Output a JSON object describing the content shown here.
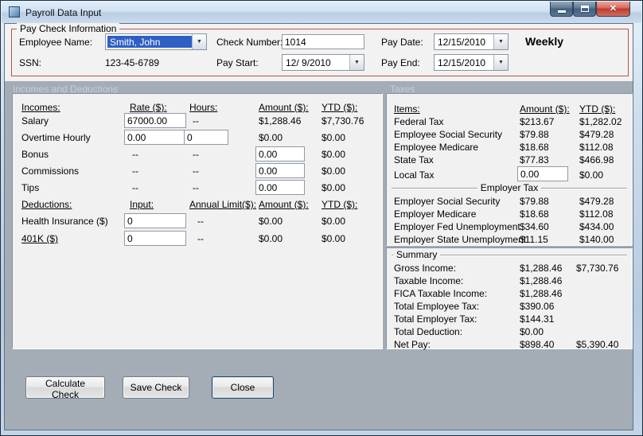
{
  "window": {
    "title": "Payroll Data Input",
    "close_glyph": "✕"
  },
  "icons": {
    "dropdown_arrow": "▼"
  },
  "paycheck": {
    "group_label": "Pay Check Information",
    "employee_name_label": "Employee Name:",
    "employee_name_value": "Smith, John",
    "ssn_label": "SSN:",
    "ssn_value": "123-45-6789",
    "check_number_label": "Check Number:",
    "check_number_value": "1014",
    "pay_start_label": "Pay Start:",
    "pay_start_value": "12/ 9/2010",
    "pay_date_label": "Pay Date:",
    "pay_date_value": "12/15/2010",
    "pay_end_label": "Pay End:",
    "pay_end_value": "12/15/2010",
    "frequency": "Weekly"
  },
  "sections": {
    "incomes_deductions": "Incomes and Deductions",
    "taxes": "Taxes"
  },
  "incomes": {
    "headers": {
      "name": "Incomes:",
      "rate": "Rate ($):",
      "hours": "Hours:",
      "amount": "Amount ($):",
      "ytd": "YTD ($):"
    },
    "salary": {
      "name": "Salary",
      "rate": "67000.00",
      "hours": "--",
      "amount": "$1,288.46",
      "ytd": "$7,730.76"
    },
    "overtime": {
      "name": "Overtime Hourly",
      "rate": "0.00",
      "hours": "0",
      "amount": "$0.00",
      "ytd": "$0.00"
    },
    "bonus": {
      "name": "Bonus",
      "rate": "--",
      "hours": "--",
      "amount": "0.00",
      "ytd": "$0.00"
    },
    "commissions": {
      "name": "Commissions",
      "rate": "--",
      "hours": "--",
      "amount": "0.00",
      "ytd": "$0.00"
    },
    "tips": {
      "name": "Tips",
      "rate": "--",
      "hours": "--",
      "amount": "0.00",
      "ytd": "$0.00"
    }
  },
  "deductions": {
    "headers": {
      "name": "Deductions:",
      "input": "Input:",
      "limit": "Annual Limit($):",
      "amount": "Amount ($):",
      "ytd": "YTD ($):"
    },
    "health": {
      "name": "Health Insurance ($)",
      "input": "0",
      "limit": "--",
      "amount": "$0.00",
      "ytd": "$0.00"
    },
    "k401": {
      "name": "401K ($)",
      "input": "0",
      "limit": "--",
      "amount": "$0.00",
      "ytd": "$0.00"
    }
  },
  "taxes": {
    "headers": {
      "items": "Items:",
      "amount": "Amount ($):",
      "ytd": "YTD ($):"
    },
    "rows": [
      {
        "name": "Federal Tax",
        "amount": "$213.67",
        "ytd": "$1,282.02"
      },
      {
        "name": "Employee Social Security",
        "amount": "$79.88",
        "ytd": "$479.28"
      },
      {
        "name": "Employee Medicare",
        "amount": "$18.68",
        "ytd": "$112.08"
      },
      {
        "name": "State Tax",
        "amount": "$77.83",
        "ytd": "$466.98"
      }
    ],
    "local": {
      "name": "Local Tax",
      "amount": "0.00",
      "ytd": "$0.00"
    },
    "employer_group_label": "Employer Tax",
    "employer_rows": [
      {
        "name": "Employer Social Security",
        "amount": "$79.88",
        "ytd": "$479.28"
      },
      {
        "name": "Employer Medicare",
        "amount": "$18.68",
        "ytd": "$112.08"
      },
      {
        "name": "Employer Fed Unemployment",
        "amount": "$34.60",
        "ytd": "$434.00"
      },
      {
        "name": "Employer State Unemployment",
        "amount": "$11.15",
        "ytd": "$140.00"
      }
    ]
  },
  "summary": {
    "group_label": "Summary",
    "rows": [
      {
        "name": "Gross Income:",
        "amount": "$1,288.46",
        "ytd": "$7,730.76"
      },
      {
        "name": "Taxable Income:",
        "amount": "$1,288.46",
        "ytd": ""
      },
      {
        "name": "FICA Taxable Income:",
        "amount": "$1,288.46",
        "ytd": ""
      },
      {
        "name": "Total Employee Tax:",
        "amount": "$390.06",
        "ytd": ""
      },
      {
        "name": "Total Employer Tax:",
        "amount": "$144.31",
        "ytd": ""
      },
      {
        "name": "Total Deduction:",
        "amount": "$0.00",
        "ytd": ""
      },
      {
        "name": "Net Pay:",
        "amount": "$898.40",
        "ytd": "$5,390.40"
      }
    ]
  },
  "buttons": {
    "calculate": "Calculate Check",
    "save": "Save Check",
    "close": "Close"
  }
}
